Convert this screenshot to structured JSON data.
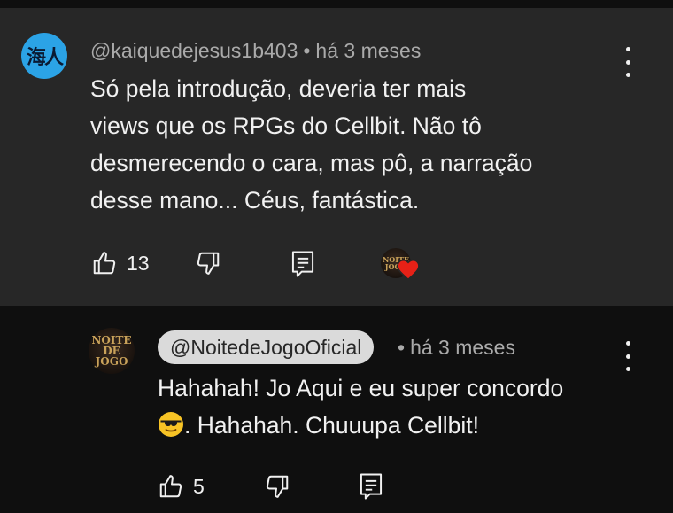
{
  "comment": {
    "avatar_text": "海人",
    "author": "@kaiquedejesus1b403",
    "separator": "•",
    "time": "há 3 meses",
    "text_lines": [
      "Só pela introdução, deveria ter mais",
      "views que os RPGs do Cellbit. Não tô",
      "desmerecendo o cara, mas pô, a narração",
      "desse mano... Céus, fantástica."
    ],
    "like_count": "13",
    "creator_heart_avatar_text": "NOITE JOGO"
  },
  "reply": {
    "avatar_text": "NOITE DE JOGO",
    "author": "@NoitedeJogoOficial",
    "separator": "•",
    "time": "há 3 meses",
    "line1": "Hahahah! Jo Aqui e eu super concordo",
    "emoji": "😎",
    "line2_rest": ". Hahahah. Chuuupa Cellbit!",
    "like_count": "5"
  },
  "icons": [
    "like-icon",
    "dislike-icon",
    "reply-icon",
    "more-vert-icon",
    "heart-icon",
    "sunglasses-emoji"
  ],
  "colors": {
    "background": "#0f0f0f",
    "card": "#272727",
    "text": "#f1f1f1",
    "secondary_text": "#aaaaaa",
    "author_chip": "#dadada",
    "heart": "#e62117",
    "avatar_blue": "#2ba3e6"
  }
}
